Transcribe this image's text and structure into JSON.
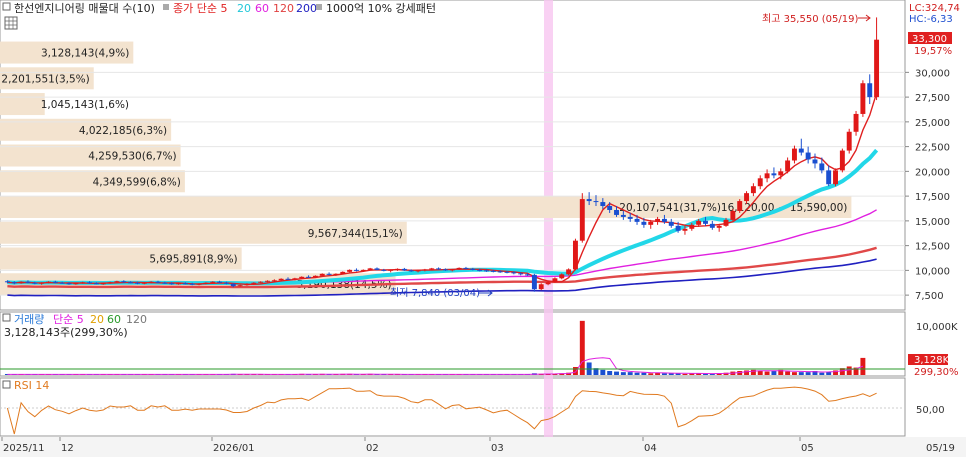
{
  "header": {
    "title": "한선엔지니어링 매물대 수(10)",
    "legend": [
      {
        "label": "종가 단순 5",
        "color": "#e02020"
      },
      {
        "label": "20",
        "color": "#22d7e8"
      },
      {
        "label": "60",
        "color": "#e020e0"
      },
      {
        "label": "120",
        "color": "#e04040"
      },
      {
        "label": "200",
        "color": "#2020c0"
      }
    ],
    "pattern": "1000억 10% 강세패턴"
  },
  "corner": {
    "lc": "LC:324,74",
    "hc": "HC:-6,33"
  },
  "price_badge": {
    "price": "33,300",
    "pct": "19,57%"
  },
  "price_axis": {
    "ticks": [
      7500,
      10000,
      12500,
      15000,
      17500,
      20000,
      22500,
      25000,
      27500,
      30000
    ],
    "tick_labels": [
      "7,500",
      "10,000",
      "12,500",
      "15,000",
      "17,500",
      "20,000",
      "22,500",
      "25,000",
      "27,500",
      "30,000"
    ]
  },
  "annotations": {
    "high": "최고 35,550 (05/19)",
    "low": "최저 7,840 (03/04)",
    "band": "20,107,541(31,7%)16,120,00 ~ 15,590,00)"
  },
  "chart_data": {
    "type": "candlestick",
    "ylim": [
      6200,
      36500
    ],
    "x_tick_labels": [
      "2025/11",
      "12",
      "2026/01",
      "02",
      "03",
      "04",
      "05",
      "05/19"
    ],
    "volume_profile": [
      {
        "label": "3,128,143(4,9%)",
        "price": 32000,
        "frac": 0.155
      },
      {
        "label": "2,201,551(3,5%)",
        "price": 29400,
        "frac": 0.109
      },
      {
        "label": "1,045,143(1,6%)",
        "price": 26800,
        "frac": 0.052
      },
      {
        "label": "4,022,185(6,3%)",
        "price": 24200,
        "frac": 0.199
      },
      {
        "label": "4,259,530(6,7%)",
        "price": 21600,
        "frac": 0.21
      },
      {
        "label": "4,349,599(6,8%)",
        "price": 19000,
        "frac": 0.215
      },
      {
        "label": "20,107,541(31,7%)16,120,00 ~ 15,590,00)",
        "price": 16400,
        "frac": 0.99
      },
      {
        "label": "9,567,344(15,1%)",
        "price": 13800,
        "frac": 0.473
      },
      {
        "label": "5,695,891(8,9%)",
        "price": 11200,
        "frac": 0.281
      },
      {
        "label": "5,190,138(14,5%)",
        "price": 8600,
        "frac": 0.46
      }
    ],
    "candles": [
      [
        8900,
        9000,
        8700,
        8800
      ],
      [
        8800,
        8900,
        8600,
        8700
      ],
      [
        8700,
        8900,
        8650,
        8850
      ],
      [
        8850,
        9000,
        8700,
        8750
      ],
      [
        8750,
        8850,
        8600,
        8650
      ],
      [
        8650,
        8800,
        8550,
        8750
      ],
      [
        8750,
        8900,
        8700,
        8850
      ],
      [
        8850,
        8950,
        8700,
        8750
      ],
      [
        8750,
        8850,
        8650,
        8700
      ],
      [
        8700,
        8800,
        8550,
        8600
      ],
      [
        8600,
        8750,
        8550,
        8700
      ],
      [
        8700,
        8850,
        8650,
        8800
      ],
      [
        8800,
        8900,
        8650,
        8700
      ],
      [
        8700,
        8800,
        8600,
        8650
      ],
      [
        8650,
        8750,
        8550,
        8700
      ],
      [
        8700,
        8850,
        8650,
        8800
      ],
      [
        8800,
        8950,
        8750,
        8900
      ],
      [
        8900,
        9000,
        8750,
        8800
      ],
      [
        8800,
        8900,
        8700,
        8750
      ],
      [
        8750,
        8850,
        8600,
        8650
      ],
      [
        8650,
        8800,
        8600,
        8750
      ],
      [
        8750,
        8900,
        8700,
        8850
      ],
      [
        8850,
        8950,
        8700,
        8750
      ],
      [
        8750,
        8850,
        8650,
        8700
      ],
      [
        8700,
        8800,
        8550,
        8600
      ],
      [
        8600,
        8750,
        8550,
        8700
      ],
      [
        8700,
        8800,
        8600,
        8650
      ],
      [
        8650,
        8750,
        8500,
        8550
      ],
      [
        8550,
        8700,
        8500,
        8650
      ],
      [
        8650,
        8800,
        8600,
        8750
      ],
      [
        8750,
        8900,
        8700,
        8850
      ],
      [
        8850,
        8950,
        8700,
        8750
      ],
      [
        8750,
        8850,
        8600,
        8650
      ],
      [
        8650,
        8700,
        8300,
        8400
      ],
      [
        8400,
        8550,
        8350,
        8500
      ],
      [
        8500,
        8700,
        8450,
        8650
      ],
      [
        8650,
        8800,
        8600,
        8750
      ],
      [
        8750,
        8900,
        8700,
        8850
      ],
      [
        8850,
        9000,
        8800,
        8950
      ],
      [
        8950,
        9100,
        8850,
        9000
      ],
      [
        9000,
        9200,
        8950,
        9150
      ],
      [
        9150,
        9300,
        9050,
        9100
      ],
      [
        9100,
        9250,
        9000,
        9200
      ],
      [
        9200,
        9400,
        9150,
        9350
      ],
      [
        9350,
        9500,
        9250,
        9300
      ],
      [
        9300,
        9500,
        9250,
        9450
      ],
      [
        9450,
        9700,
        9400,
        9650
      ],
      [
        9650,
        9800,
        9500,
        9550
      ],
      [
        9550,
        9700,
        9450,
        9650
      ],
      [
        9650,
        9900,
        9600,
        9850
      ],
      [
        9850,
        10100,
        9800,
        10050
      ],
      [
        10050,
        10200,
        9900,
        9950
      ],
      [
        9950,
        10100,
        9850,
        10050
      ],
      [
        10050,
        10250,
        10000,
        10200
      ],
      [
        10200,
        10300,
        10000,
        10050
      ],
      [
        10050,
        10150,
        9900,
        9950
      ],
      [
        9950,
        10100,
        9800,
        10050
      ],
      [
        10050,
        10200,
        9950,
        10150
      ],
      [
        10150,
        10250,
        9950,
        10000
      ],
      [
        10000,
        10100,
        9850,
        9900
      ],
      [
        9900,
        10050,
        9800,
        10000
      ],
      [
        10000,
        10150,
        9900,
        10100
      ],
      [
        10100,
        10250,
        10000,
        10200
      ],
      [
        10200,
        10300,
        10050,
        10100
      ],
      [
        10100,
        10200,
        9950,
        10000
      ],
      [
        10000,
        10150,
        9900,
        10100
      ],
      [
        10100,
        10300,
        10050,
        10250
      ],
      [
        10250,
        10350,
        10100,
        10150
      ],
      [
        10150,
        10250,
        10000,
        10050
      ],
      [
        10050,
        10150,
        9900,
        10000
      ],
      [
        10000,
        10100,
        9850,
        9950
      ],
      [
        9950,
        10050,
        9800,
        9900
      ],
      [
        9900,
        10000,
        9750,
        9850
      ],
      [
        9850,
        9950,
        9700,
        9800
      ],
      [
        9800,
        9900,
        9600,
        9700
      ],
      [
        9700,
        9800,
        9500,
        9600
      ],
      [
        9600,
        9700,
        9450,
        9550
      ],
      [
        9550,
        9650,
        7840,
        8100
      ],
      [
        8100,
        8700,
        8000,
        8600
      ],
      [
        8600,
        8900,
        8500,
        8800
      ],
      [
        8800,
        9300,
        8750,
        9200
      ],
      [
        9200,
        9700,
        9100,
        9600
      ],
      [
        9600,
        10200,
        9500,
        10100
      ],
      [
        10100,
        13200,
        10000,
        13000
      ],
      [
        13000,
        17800,
        12800,
        17200
      ],
      [
        17200,
        17900,
        16600,
        17000
      ],
      [
        17000,
        17600,
        16500,
        16900
      ],
      [
        16900,
        17300,
        16200,
        16500
      ],
      [
        16500,
        16900,
        15800,
        16100
      ],
      [
        16100,
        16500,
        15400,
        15600
      ],
      [
        15600,
        16000,
        15100,
        15400
      ],
      [
        15400,
        15800,
        14900,
        15200
      ],
      [
        15200,
        15600,
        14600,
        14900
      ],
      [
        14900,
        15300,
        14300,
        14600
      ],
      [
        14600,
        15100,
        14200,
        14900
      ],
      [
        14900,
        15400,
        14600,
        15200
      ],
      [
        15200,
        15600,
        14700,
        14900
      ],
      [
        14900,
        15200,
        14300,
        14500
      ],
      [
        14500,
        14900,
        13800,
        14000
      ],
      [
        14000,
        14500,
        13600,
        14200
      ],
      [
        14200,
        14800,
        14000,
        14600
      ],
      [
        14600,
        15200,
        14400,
        15000
      ],
      [
        15000,
        15400,
        14500,
        14700
      ],
      [
        14700,
        15000,
        14100,
        14300
      ],
      [
        14300,
        14700,
        13900,
        14500
      ],
      [
        14500,
        15300,
        14400,
        15100
      ],
      [
        15100,
        16200,
        15000,
        16000
      ],
      [
        16000,
        17200,
        15800,
        17000
      ],
      [
        17000,
        18000,
        16700,
        17800
      ],
      [
        17800,
        18800,
        17500,
        18500
      ],
      [
        18500,
        19600,
        18200,
        19300
      ],
      [
        19300,
        20200,
        18900,
        19800
      ],
      [
        19800,
        20400,
        19300,
        19600
      ],
      [
        19600,
        20300,
        19200,
        20000
      ],
      [
        20000,
        21400,
        19800,
        21100
      ],
      [
        21100,
        22600,
        20800,
        22300
      ],
      [
        22300,
        23300,
        21600,
        21900
      ],
      [
        21900,
        22500,
        20800,
        21200
      ],
      [
        21200,
        21800,
        20300,
        20800
      ],
      [
        20800,
        21400,
        19800,
        20100
      ],
      [
        20100,
        20600,
        18500,
        18700
      ],
      [
        18700,
        20300,
        18500,
        20100
      ],
      [
        20100,
        22300,
        19900,
        22100
      ],
      [
        22100,
        24300,
        21800,
        24000
      ],
      [
        24000,
        26100,
        23600,
        25800
      ],
      [
        25800,
        29200,
        25500,
        28900
      ],
      [
        28900,
        29800,
        26800,
        27500
      ],
      [
        27500,
        35550,
        27200,
        33300
      ]
    ],
    "volume": [
      0.01,
      0.01,
      0.01,
      0.01,
      0.01,
      0.01,
      0.01,
      0.01,
      0.01,
      0.01,
      0.01,
      0.01,
      0.01,
      0.01,
      0.01,
      0.01,
      0.01,
      0.01,
      0.01,
      0.01,
      0.01,
      0.01,
      0.01,
      0.01,
      0.01,
      0.01,
      0.01,
      0.01,
      0.01,
      0.01,
      0.01,
      0.01,
      0.01,
      0.02,
      0.01,
      0.01,
      0.01,
      0.01,
      0.01,
      0.01,
      0.01,
      0.01,
      0.01,
      0.02,
      0.01,
      0.01,
      0.02,
      0.01,
      0.01,
      0.02,
      0.02,
      0.01,
      0.01,
      0.02,
      0.01,
      0.01,
      0.01,
      0.01,
      0.01,
      0.01,
      0.01,
      0.01,
      0.01,
      0.01,
      0.01,
      0.01,
      0.01,
      0.01,
      0.01,
      0.01,
      0.01,
      0.01,
      0.01,
      0.01,
      0.01,
      0.01,
      0.01,
      0.03,
      0.02,
      0.02,
      0.02,
      0.03,
      0.04,
      0.14,
      0.95,
      0.22,
      0.12,
      0.09,
      0.07,
      0.06,
      0.05,
      0.05,
      0.04,
      0.04,
      0.03,
      0.04,
      0.03,
      0.03,
      0.03,
      0.02,
      0.03,
      0.03,
      0.02,
      0.02,
      0.03,
      0.04,
      0.06,
      0.07,
      0.08,
      0.09,
      0.07,
      0.06,
      0.07,
      0.09,
      0.06,
      0.05,
      0.05,
      0.05,
      0.07,
      0.04,
      0.06,
      0.08,
      0.12,
      0.15,
      0.13,
      0.3
    ],
    "rsi_value_label": "50,00",
    "volume_axis_label": "10,000K",
    "volume_badge": {
      "value": "3,128K",
      "pct": "299,30%"
    }
  },
  "lower_legend": {
    "volume": [
      {
        "label": "거래량",
        "color": "#2a7ad8"
      },
      {
        "label": "단순 5",
        "color": "#e020e0"
      },
      {
        "label": "20",
        "color": "#e0a000"
      },
      {
        "label": "60",
        "color": "#2a9a2a"
      },
      {
        "label": "120",
        "color": "#777777"
      }
    ],
    "volume_info": "3,128,143주(299,30%)",
    "rsi": "RSI 14"
  }
}
